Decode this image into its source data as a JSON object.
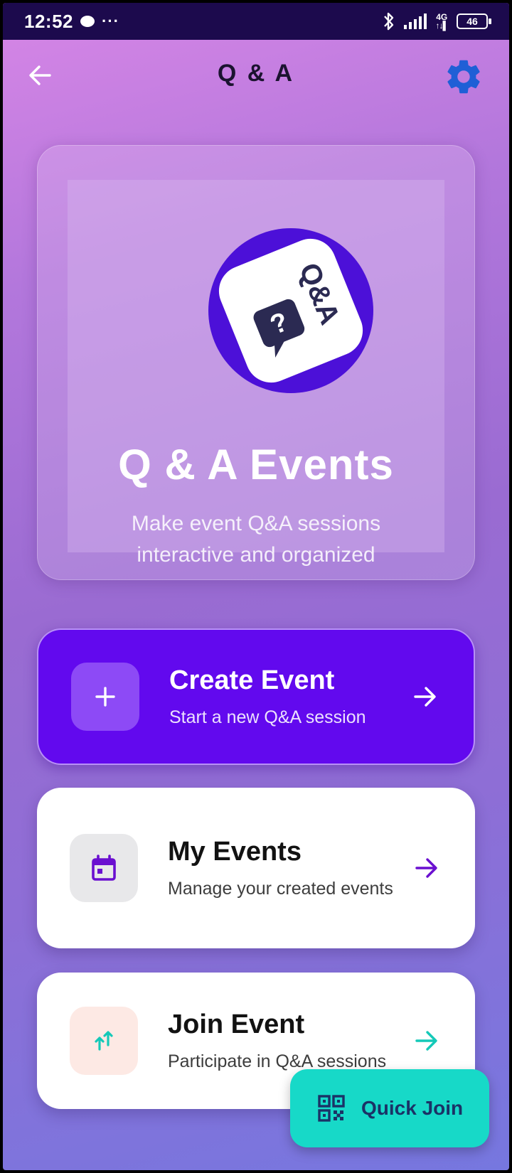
{
  "status_bar": {
    "time": "12:52",
    "dots": "···",
    "network": "4G",
    "battery": "46"
  },
  "header": {
    "title": "Q & A",
    "back_icon": "arrow-left-icon",
    "settings_icon": "gear-icon"
  },
  "hero": {
    "logo_text": "Q&A",
    "logo_icon": "qa-chat-bubble-icon",
    "title": "Q & A Events",
    "subtitle": "Make event Q&A sessions interactive and organized"
  },
  "cards": [
    {
      "title": "Create Event",
      "description": "Start a new Q&A session",
      "icon": "plus-icon",
      "arrow_icon": "arrow-right-icon"
    },
    {
      "title": "My Events",
      "description": "Manage your created events",
      "icon": "calendar-icon",
      "arrow_icon": "arrow-right-icon"
    },
    {
      "title": "Join Event",
      "description": "Participate in Q&A sessions",
      "icon": "arrows-up-down-icon",
      "arrow_icon": "arrow-right-icon"
    }
  ],
  "quick_join": {
    "label": "Quick Join",
    "icon": "qr-code-icon"
  },
  "colors": {
    "primary": "#6209ee",
    "logo_circle": "#4c10d8",
    "accent_teal": "#17d9c8",
    "settings_icon": "#1f5fd6",
    "calendar_icon": "#6a0fd0",
    "join_icon": "#14c9b8",
    "status_bar": "#1c0a4d"
  }
}
